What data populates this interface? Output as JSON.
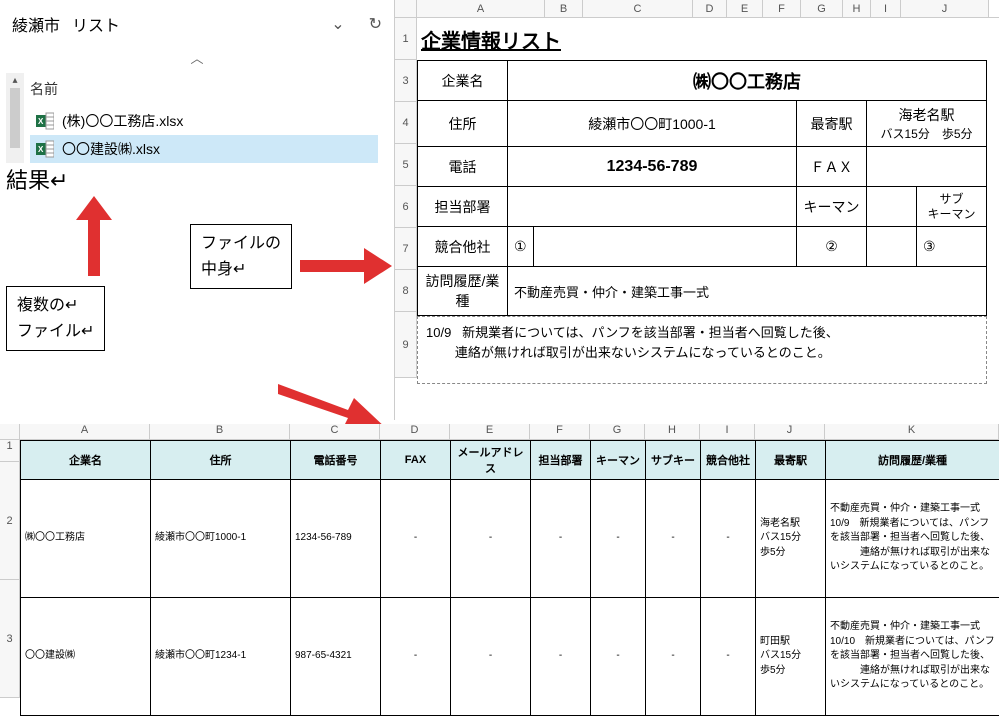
{
  "explorer": {
    "folder": "綾瀬市",
    "view_label": "リスト",
    "name_header": "名前",
    "files": [
      {
        "name": "(株)〇〇工務店.xlsx",
        "selected": false
      },
      {
        "name": "〇〇建設㈱.xlsx",
        "selected": true
      }
    ]
  },
  "callouts": {
    "multiple_files_l1": "複数の↵",
    "multiple_files_l2": "ファイル↵",
    "file_contents_l1": "ファイルの",
    "file_contents_l2": "中身↵",
    "result": "結果↵"
  },
  "sheet": {
    "col_letters": [
      "A",
      "B",
      "C",
      "D",
      "E",
      "F",
      "G",
      "H",
      "I",
      "J"
    ],
    "row_nums": [
      "1",
      "3",
      "4",
      "5",
      "6",
      "7",
      "8",
      "9"
    ],
    "title": "企業情報リスト",
    "labels": {
      "company": "企業名",
      "address": "住所",
      "phone": "電話",
      "dept": "担当部署",
      "competitor": "競合他社",
      "visit": "訪問履歴/業種",
      "station": "最寄駅",
      "fax": "ＦＡＸ",
      "keyman": "キーマン",
      "subkey_l1": "サブ",
      "subkey_l2": "キーマン"
    },
    "values": {
      "company": "㈱〇〇工務店",
      "address": "綾瀬市〇〇町1000-1",
      "station_l1": "海老名駅",
      "station_l2": "バス15分　歩5分",
      "phone": "1234-56-789",
      "num1": "①",
      "num2": "②",
      "num3": "③",
      "visit": "不動産売買・仲介・建築工事一式",
      "memo_date": "10/9",
      "memo_l1": "新規業者については、パンフを該当部署・担当者へ回覧した後、",
      "memo_l2": "連絡が無ければ取引が出来ないシステムになっているとのこと。"
    }
  },
  "result": {
    "col_letters": [
      "A",
      "B",
      "C",
      "D",
      "E",
      "F",
      "G",
      "H",
      "I",
      "J",
      "K"
    ],
    "row_nums": [
      "1",
      "2",
      "3"
    ],
    "headers": [
      "企業名",
      "住所",
      "電話番号",
      "FAX",
      "メールアドレス",
      "担当部署",
      "キーマン",
      "サブキー",
      "競合他社",
      "最寄駅",
      "訪問履歴/業種"
    ],
    "rows": [
      {
        "company": "㈱〇〇工務店",
        "address": "綾瀬市〇〇町1000-1",
        "phone": "1234-56-789",
        "fax": "-",
        "mail": "-",
        "dept": "-",
        "keyman": "-",
        "sub": "-",
        "comp": "-",
        "station": "海老名駅\nバス15分\n歩5分",
        "visit": "不動産売買・仲介・建築工事一式\n10/9　新規業者については、パンフを該当部署・担当者へ回覧した後、\n　　　連絡が無ければ取引が出来ないシステムになっているとのこと。"
      },
      {
        "company": "〇〇建設㈱",
        "address": "綾瀬市〇〇町1234-1",
        "phone": "987-65-4321",
        "fax": "-",
        "mail": "-",
        "dept": "-",
        "keyman": "-",
        "sub": "-",
        "comp": "-",
        "station": "町田駅\nバス15分\n歩5分",
        "visit": "不動産売買・仲介・建築工事一式\n10/10　新規業者については、パンフを該当部署・担当者へ回覧した後、\n　　　連絡が無ければ取引が出来ないシステムになっているとのこと。"
      }
    ]
  }
}
